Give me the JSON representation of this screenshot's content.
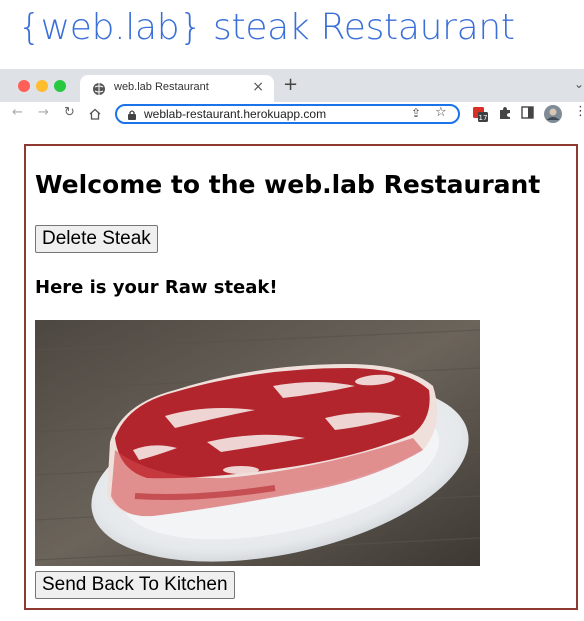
{
  "headline": "{web.lab} steak Restaurant",
  "browser": {
    "tab_title": "web.lab Restaurant",
    "tab_close": "×",
    "new_tab": "+",
    "url": "weblab-restaurant.herokuapp.com",
    "calendar_badge": "17",
    "traffic_colors": [
      "#ff5f57",
      "#febc2e",
      "#28c840"
    ]
  },
  "page": {
    "title": "Welcome to the web.lab Restaurant",
    "delete_button": "Delete Steak",
    "status_message": "Here is your Raw steak!",
    "send_back_button": "Send Back To Kitchen"
  },
  "colors": {
    "headline": "#3b6fd8",
    "frame_border": "#8e3a32",
    "omnibox_focus": "#1a73e8"
  }
}
